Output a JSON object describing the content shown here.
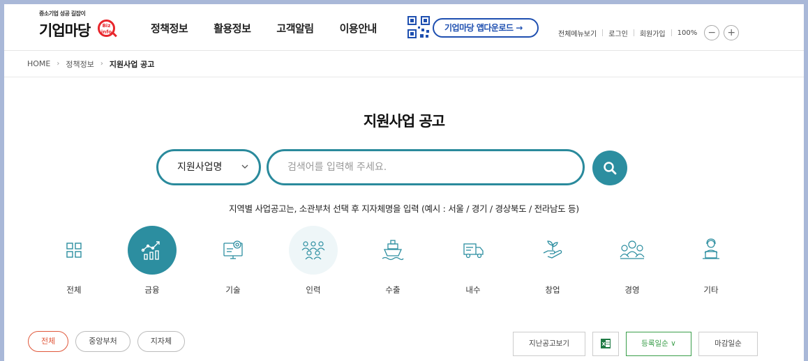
{
  "header": {
    "logo_tagline": "중소기업 성공 길잡이",
    "logo_text": "기업마당",
    "logo_badge": "Biz info",
    "nav": [
      "정책정보",
      "활용정보",
      "고객알림",
      "이용안내"
    ],
    "app_download": "기업마당 앱다운로드 →",
    "utils": {
      "sitemap": "전체메뉴보기",
      "login": "로그인",
      "join": "회원가입",
      "zoom": "100%",
      "zoom_out": "−",
      "zoom_in": "+"
    }
  },
  "breadcrumb": {
    "home": "HOME",
    "level1": "정책정보",
    "current": "지원사업 공고",
    "sep": "›"
  },
  "page_title": "지원사업 공고",
  "search": {
    "select_value": "지원사업명",
    "placeholder": "검색어를 입력해 주세요.",
    "hint": "지역별 사업공고는, 소관부처 선택 후 지자체명을 입력 (예시 : 서울 / 경기 / 경상북도 / 전라남도 등)"
  },
  "categories": [
    {
      "label": "전체",
      "icon": "grid-icon"
    },
    {
      "label": "금융",
      "icon": "finance-chart-icon",
      "active": true
    },
    {
      "label": "기술",
      "icon": "technology-monitor-icon"
    },
    {
      "label": "인력",
      "icon": "people-icon"
    },
    {
      "label": "수출",
      "icon": "ship-icon"
    },
    {
      "label": "내수",
      "icon": "truck-icon"
    },
    {
      "label": "창업",
      "icon": "sprout-hand-icon"
    },
    {
      "label": "경영",
      "icon": "management-group-icon"
    },
    {
      "label": "기타",
      "icon": "person-laptop-icon"
    }
  ],
  "filters": {
    "chips": [
      "전체",
      "중앙부처",
      "지자체"
    ],
    "past_notices": "지난공고보기",
    "sort_registered": "등록일순 ∨",
    "sort_deadline": "마감일순"
  },
  "colors": {
    "accent": "#2c8ea0",
    "brand_blue": "#1e4fb0",
    "logo_red": "#e8262c",
    "chip_active": "#e0573a",
    "sort_green": "#3a9e4a"
  }
}
